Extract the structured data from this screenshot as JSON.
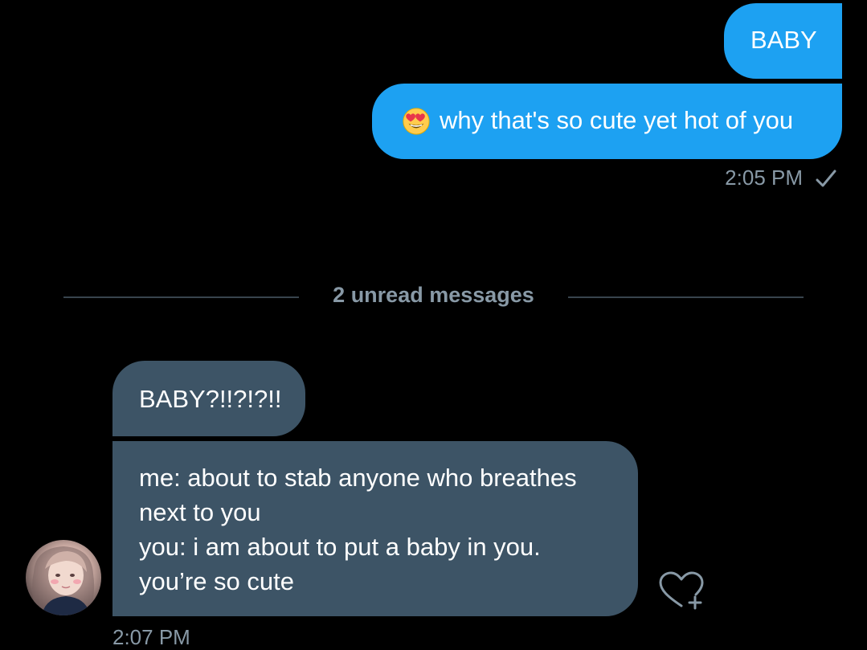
{
  "conversation": {
    "sent_messages": [
      {
        "text": "BABY"
      },
      {
        "text": "why that's so cute yet hot of you",
        "emoji": "heart-eyes-emoji"
      }
    ],
    "sent_timestamp": "2:05 PM",
    "sent_status_icon": "checkmark-icon",
    "unread_divider": "2 unread messages",
    "received_messages": [
      {
        "text": "BABY?!!?!?!!"
      },
      {
        "lines": [
          "me: about to stab anyone who breathes",
          "next to you",
          "you: i am about to put a baby in you.",
          "you’re so cute"
        ]
      }
    ],
    "received_timestamp": "2:07 PM",
    "react_icon": "heart-plus-icon"
  },
  "colors": {
    "background": "#000000",
    "sent_bubble": "#1da1f2",
    "received_bubble": "#3d5466",
    "meta_text": "#8899a6",
    "divider": "#38444d"
  }
}
